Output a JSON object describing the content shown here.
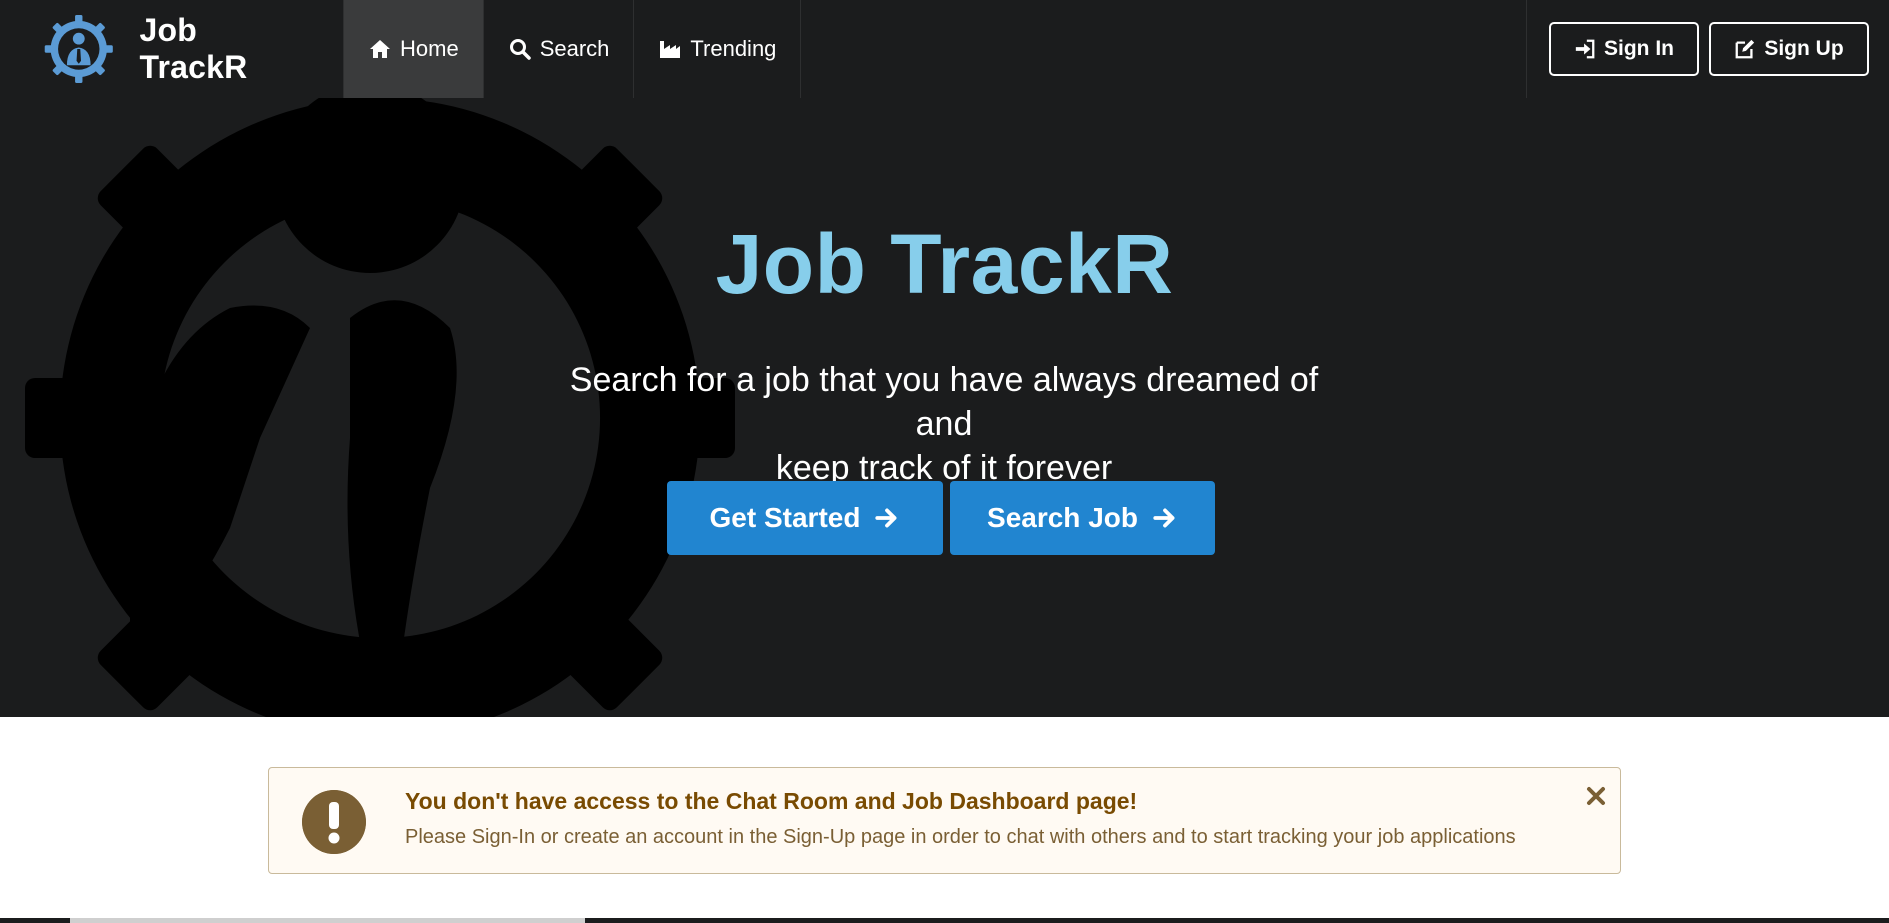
{
  "brand": {
    "name": "Job TrackR",
    "logo_icon": "gear-person-logo-icon"
  },
  "nav": {
    "items": [
      {
        "label": "Home",
        "icon": "home-icon",
        "active": true
      },
      {
        "label": "Search",
        "icon": "search-icon",
        "active": false
      },
      {
        "label": "Trending",
        "icon": "industry-icon",
        "active": false
      }
    ],
    "sign_in": {
      "label": "Sign In",
      "icon": "sign-in-icon"
    },
    "sign_up": {
      "label": "Sign Up",
      "icon": "edit-icon"
    }
  },
  "hero": {
    "title": "Job TrackR",
    "subtitle_line1": "Search for a job that you have always dreamed of and",
    "subtitle_line2": "keep track of it forever",
    "get_started_label": "Get Started",
    "search_job_label": "Search Job"
  },
  "message": {
    "header": "You don't have access to the Chat Room and Job Dashboard page!",
    "body": "Please Sign-In or create an account in the Sign-Up page in order to chat with others and to start tracking your job applications",
    "icon": "exclamation-icon"
  },
  "colors": {
    "navbar_bg": "#1b1c1d",
    "hero_title": "#87ceeb",
    "primary_button": "#2185d0",
    "warning_bg": "#fffaf3",
    "warning_text": "#794b02",
    "logo_blue": "#5b9bd5"
  }
}
